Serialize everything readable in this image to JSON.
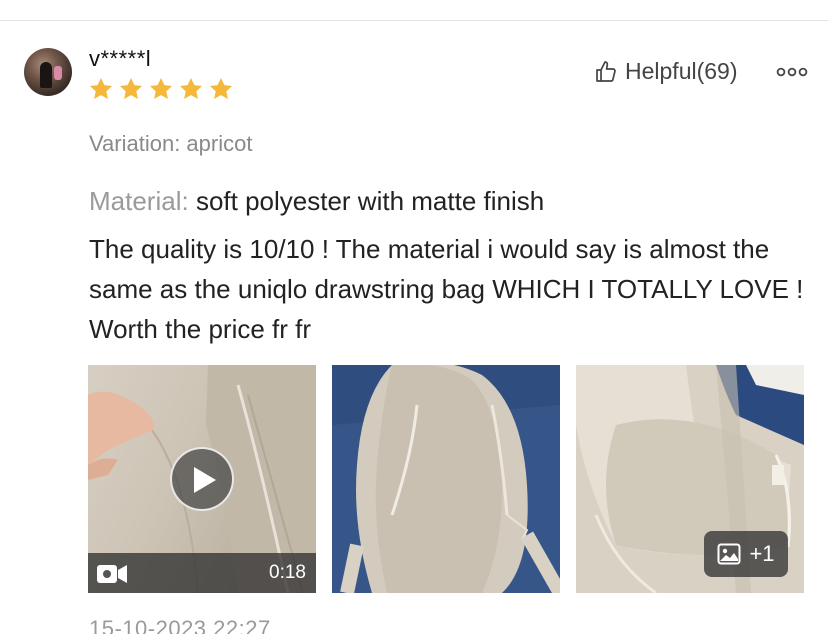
{
  "review": {
    "username": "v*****l",
    "rating": 5,
    "helpful_label": "Helpful(69)",
    "variation": "Variation: apricot",
    "material_label": "Material:",
    "material_value": "soft polyester with matte finish",
    "text": "The quality is 10/10 ! The material i would say is almost the same as the uniqlo drawstring bag WHICH I TOTALLY LOVE !  Worth the price fr fr",
    "media": {
      "video_duration": "0:18",
      "extra_count": "+1"
    },
    "timestamp": "15-10-2023 22:27"
  },
  "colors": {
    "star": "#F5B83A",
    "divider": "#e3e3e3",
    "muted_text": "#8a8a8a"
  },
  "icons": [
    "thumbs-up-icon",
    "more-options-icon",
    "play-icon",
    "video-camera-icon",
    "image-icon",
    "star-icon"
  ]
}
